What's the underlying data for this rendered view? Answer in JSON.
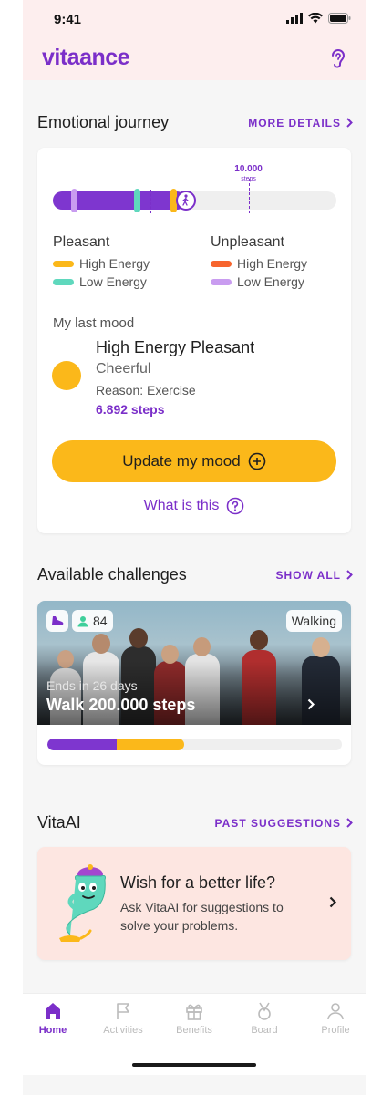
{
  "status_bar": {
    "time": "9:41"
  },
  "header": {
    "logo": "vitaance",
    "icon": "ear-icon"
  },
  "journey": {
    "title": "Emotional journey",
    "more_link": "MORE DETAILS",
    "goal_value": "10.000",
    "goal_unit": "steps",
    "progress_fraction": 0.47,
    "goal_fraction": 0.69,
    "legend": {
      "pleasant": {
        "heading": "Pleasant",
        "high": "High Energy",
        "low": "Low Energy",
        "high_color": "#fbb81a",
        "low_color": "#5fd8bd"
      },
      "unpleasant": {
        "heading": "Unpleasant",
        "high": "High Energy",
        "low": "Low Energy",
        "high_color": "#f7652e",
        "low_color": "#c99cf0"
      }
    },
    "last_mood_label": "My last mood",
    "mood_title": "High Energy Pleasant",
    "mood_sub": "Cheerful",
    "mood_reason": "Reason: Exercise",
    "mood_steps": "6.892 steps",
    "update_button": "Update my mood",
    "what_link": "What is this"
  },
  "challenges": {
    "title": "Available challenges",
    "link": "SHOW ALL",
    "card": {
      "participants": "84",
      "tag": "Walking",
      "ends": "Ends in 26 days",
      "title": "Walk 200.000 steps",
      "progress_purple_fraction": 0.235,
      "progress_yellow_fraction": 0.23
    }
  },
  "vitaai": {
    "title": "VitaAI",
    "link": "PAST SUGGESTIONS",
    "card_title": "Wish for a better life?",
    "card_desc": "Ask VitaAI for suggestions to solve your problems."
  },
  "nav": {
    "items": [
      {
        "label": "Home",
        "icon": "home-icon",
        "active": true
      },
      {
        "label": "Activities",
        "icon": "flag-icon",
        "active": false
      },
      {
        "label": "Benefits",
        "icon": "gift-icon",
        "active": false
      },
      {
        "label": "Board",
        "icon": "medal-icon",
        "active": false
      },
      {
        "label": "Profile",
        "icon": "profile-icon",
        "active": false
      }
    ]
  },
  "colors": {
    "brand": "#7b2fc9",
    "accent": "#fbb81a",
    "header_bg": "#fdeeee",
    "vita_bg": "#fde6e1"
  }
}
